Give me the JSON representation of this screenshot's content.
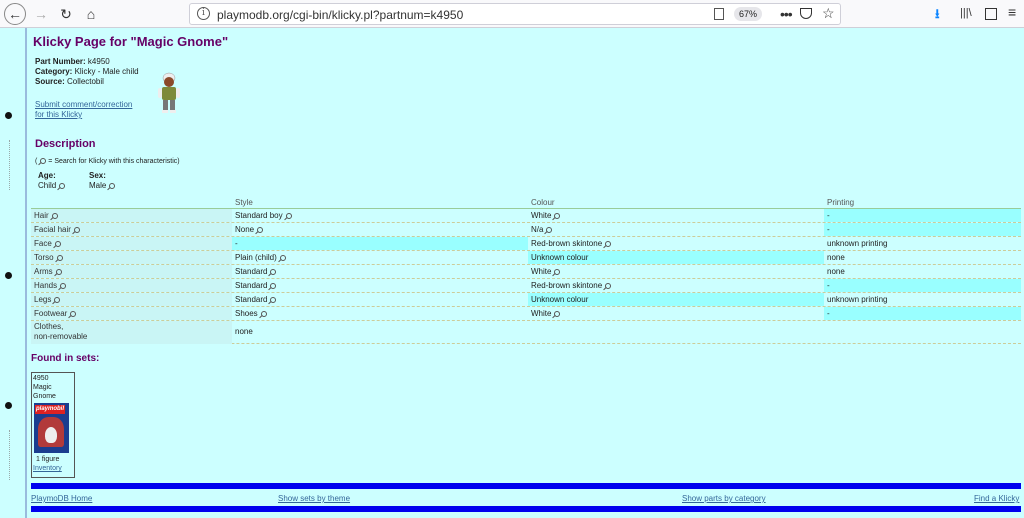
{
  "browser": {
    "url": "playmodb.org/cgi-bin/klicky.pl?partnum=k4950",
    "zoom": "67%"
  },
  "page": {
    "title": "Klicky Page for \"Magic Gnome\"",
    "part_number_label": "Part Number:",
    "part_number": "k4950",
    "category_label": "Category:",
    "category": "Klicky - Male child",
    "source_label": "Source:",
    "source": "Collectobil",
    "submit_link_line1": "Submit comment/correction",
    "submit_link_line2": "for this Klicky",
    "description_heading": "Description",
    "search_legend": "= Search for Klicky with this characteristic)",
    "age_label": "Age:",
    "age_value": "Child",
    "sex_label": "Sex:",
    "sex_value": "Male"
  },
  "table": {
    "headers": [
      "Style",
      "Colour",
      "Printing"
    ],
    "rows": [
      {
        "part": "Hair",
        "style": "Standard boy",
        "colour": "White",
        "printing": "-"
      },
      {
        "part": "Facial hair",
        "style": "None",
        "colour": "N/a",
        "printing": "-"
      },
      {
        "part": "Face",
        "style": "-",
        "colour": "Red-brown skintone",
        "printing": "unknown printing"
      },
      {
        "part": "Torso",
        "style": "Plain (child)",
        "colour": "Unknown colour",
        "printing": "none"
      },
      {
        "part": "Arms",
        "style": "Standard",
        "colour": "White",
        "printing": "none"
      },
      {
        "part": "Hands",
        "style": "Standard",
        "colour": "Red-brown skintone",
        "printing": "-"
      },
      {
        "part": "Legs",
        "style": "Standard",
        "colour": "Unknown colour",
        "printing": "unknown printing"
      },
      {
        "part": "Footwear",
        "style": "Shoes",
        "colour": "White",
        "printing": "-"
      },
      {
        "part_line1": "Clothes,",
        "part_line2": "non-removable",
        "style": "none"
      }
    ]
  },
  "sets": {
    "heading": "Found in sets:",
    "set_number": "4950",
    "set_name": "Magic Gnome",
    "box_logo": "playmobil",
    "figure_count": "1 figure",
    "inventory_link": "Inventory"
  },
  "footer": {
    "home": "PlaymoDB Home",
    "by_theme": "Show sets by theme",
    "by_category": "Show parts by category",
    "find": "Find a Klicky"
  },
  "colors": {
    "background": "#ccffff",
    "heading": "#660066",
    "link": "#336699",
    "bar": "#0000ee",
    "highlight": "#99ffff"
  }
}
